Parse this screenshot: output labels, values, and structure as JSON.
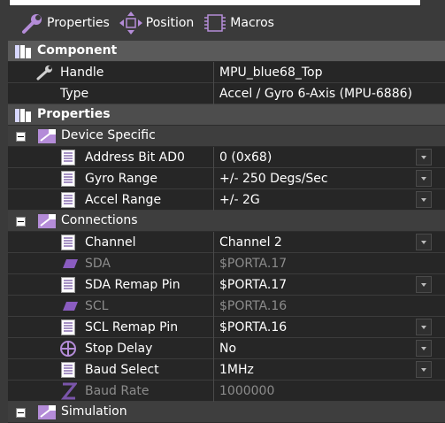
{
  "toolbar": {
    "properties_label": "Properties",
    "position_label": "Position",
    "macros_label": "Macros"
  },
  "component": {
    "header": "Component",
    "rows": [
      {
        "label": "Handle",
        "value": "MPU_blue68_Top",
        "icon": "wrench-icon"
      },
      {
        "label": "Type",
        "value": "Accel / Gyro 6-Axis (MPU-6886)",
        "icon": ""
      }
    ]
  },
  "properties": {
    "header": "Properties",
    "groups": [
      {
        "label": "Device Specific",
        "items": [
          {
            "label": "Address Bit AD0",
            "value": "0 (0x68)",
            "icon": "list-icon",
            "dropdown": true,
            "dim": false
          },
          {
            "label": "Gyro Range",
            "value": "+/- 250 Degs/Sec",
            "icon": "list-icon",
            "dropdown": true,
            "dim": false
          },
          {
            "label": "Accel Range",
            "value": "+/- 2G",
            "icon": "list-icon",
            "dropdown": true,
            "dim": false
          }
        ]
      },
      {
        "label": "Connections",
        "items": [
          {
            "label": "Channel",
            "value": "Channel 2",
            "icon": "list-icon",
            "dropdown": true,
            "dim": false
          },
          {
            "label": "SDA",
            "value": "$PORTA.17",
            "icon": "pin-icon",
            "dropdown": false,
            "dim": true
          },
          {
            "label": "SDA Remap Pin",
            "value": "$PORTA.17",
            "icon": "list-icon",
            "dropdown": true,
            "dim": false
          },
          {
            "label": "SCL",
            "value": "$PORTA.16",
            "icon": "pin-icon",
            "dropdown": false,
            "dim": true
          },
          {
            "label": "SCL Remap Pin",
            "value": "$PORTA.16",
            "icon": "list-icon",
            "dropdown": true,
            "dim": false
          },
          {
            "label": "Stop Delay",
            "value": "No",
            "icon": "circle-plus-icon",
            "dropdown": true,
            "dim": false
          },
          {
            "label": "Baud Select",
            "value": "1MHz",
            "icon": "list-icon",
            "dropdown": true,
            "dim": false
          },
          {
            "label": "Baud Rate",
            "value": "1000000",
            "icon": "z-icon",
            "dropdown": false,
            "dim": true
          }
        ]
      },
      {
        "label": "Simulation",
        "items": []
      }
    ]
  },
  "colors": {
    "background": "#3a3a3a",
    "header_row": "#5a5a5a",
    "item_row": "#262626",
    "icon_purple": "#b48cd8",
    "dim_text": "#8c8c8c"
  }
}
